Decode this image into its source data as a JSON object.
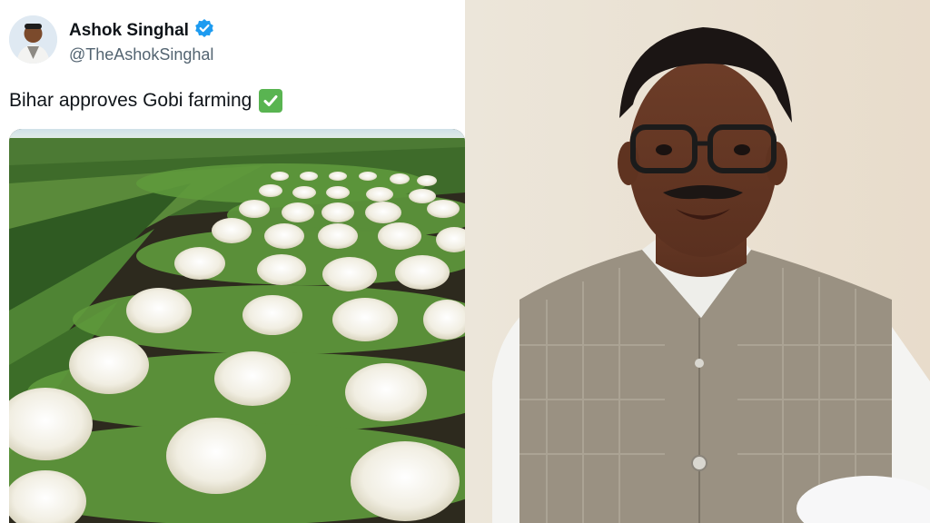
{
  "tweet": {
    "author_name": "Ashok Singhal",
    "handle": "@TheAshokSinghal",
    "text": "Bihar approves Gobi farming",
    "emoji": "white-heavy-check-mark",
    "verified_badge_icon": "verified-badge-icon"
  },
  "media": {
    "description_icon": "cauliflower-field-photo"
  },
  "right_photo": {
    "description_icon": "speaker-portrait-photo"
  },
  "colors": {
    "verified_blue": "#1d9bf0",
    "handle_gray": "#536471",
    "emoji_green": "#59b451"
  }
}
